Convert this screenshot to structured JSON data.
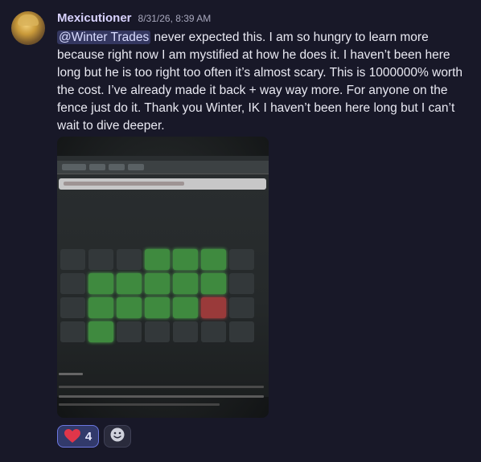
{
  "message": {
    "username": "Mexicutioner",
    "timestamp": "8/31/26, 8:39 AM",
    "mention": "@Winter Trades",
    "body": " never expected this. I am so hungry to learn more because right now I am mystified at how he does it. I haven’t been here long but he is too right too often it’s almost scary. This is 1000000% worth the cost. I’ve already made it back + way way more. For anyone on the fence just do it. Thank you Winter, IK I haven’t been here long but I can’t wait to dive deeper."
  },
  "reactions": [
    {
      "emoji": "heart-icon",
      "count": "4"
    },
    {
      "emoji": "add-reaction-icon"
    }
  ],
  "colors": {
    "background": "#181828",
    "username": "#d8d2ff",
    "mention_bg": "#5f68c4",
    "reaction_accent": "#6b77e0"
  }
}
